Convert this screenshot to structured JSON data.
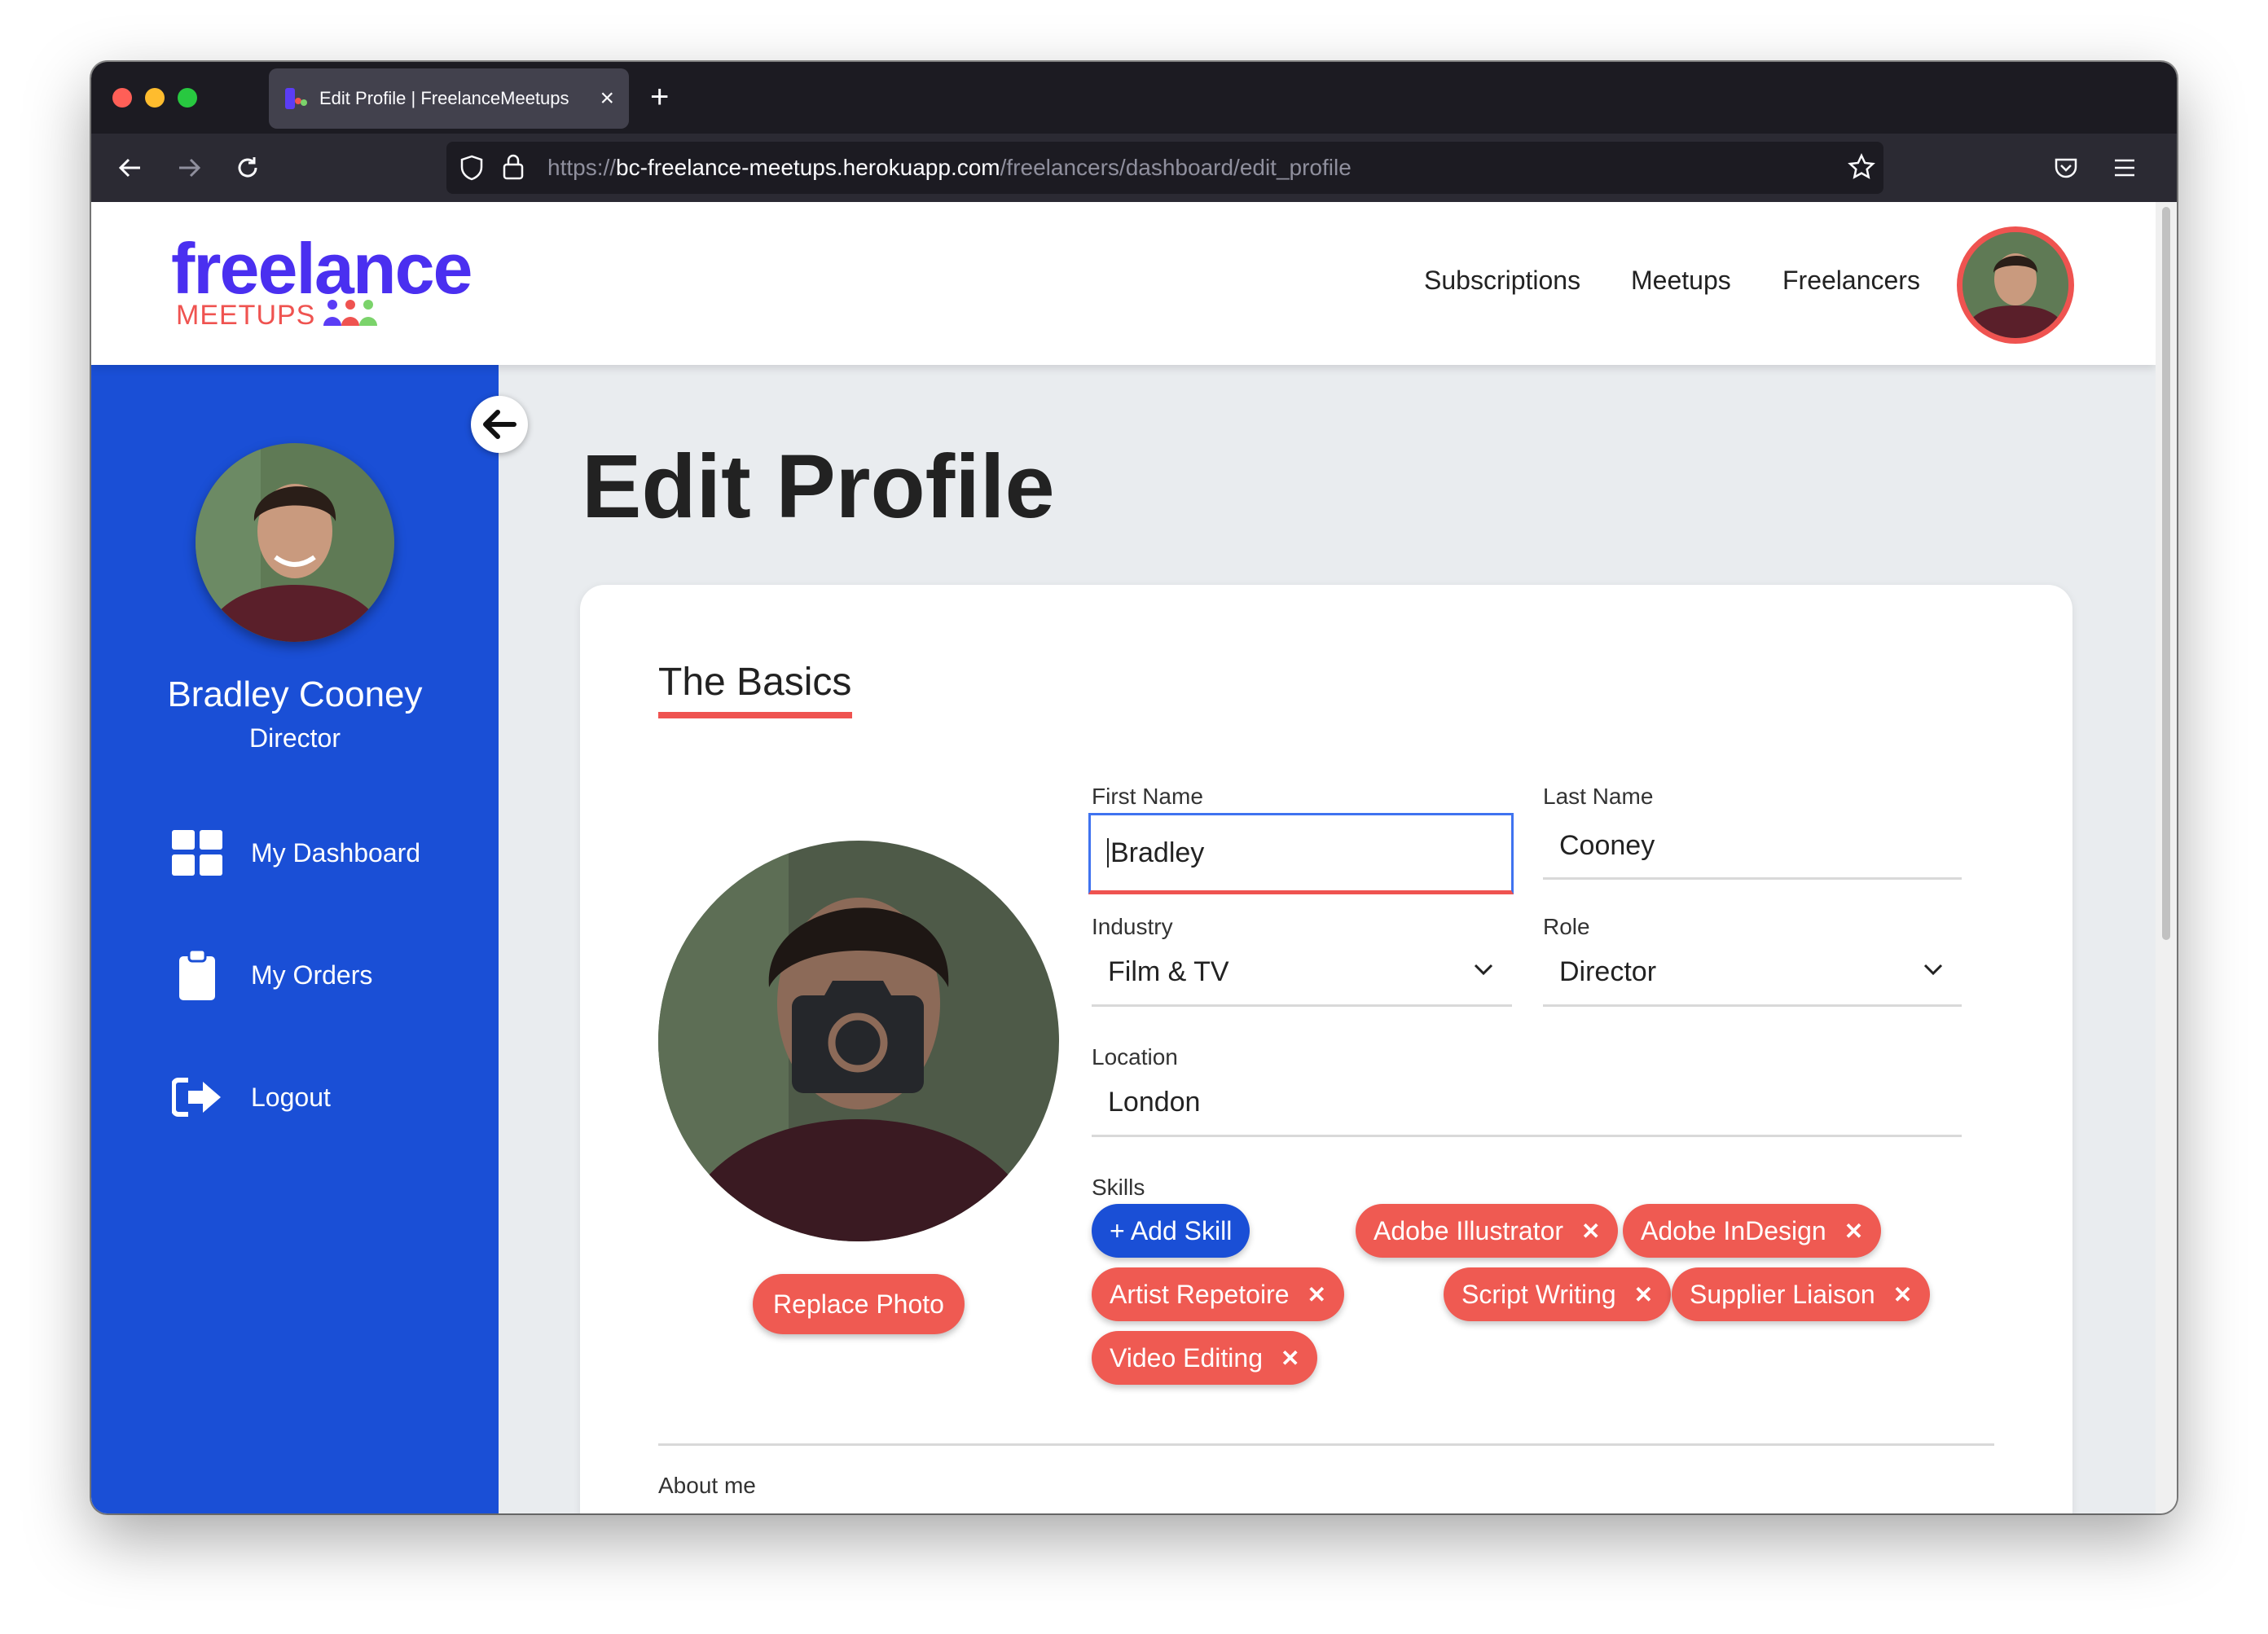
{
  "browser": {
    "tab_title": "Edit Profile | FreelanceMeetups",
    "url_prefix": "https://",
    "url_host": "bc-freelance-meetups.herokuapp.com",
    "url_path": "/freelancers/dashboard/edit_profile"
  },
  "header": {
    "logo_top": "freelance",
    "logo_bottom": "MEETUPS",
    "links": [
      "Subscriptions",
      "Meetups",
      "Freelancers"
    ]
  },
  "sidebar": {
    "name": "Bradley Cooney",
    "role": "Director",
    "items": [
      {
        "label": "My Dashboard",
        "icon": "dashboard-grid-icon"
      },
      {
        "label": "My Orders",
        "icon": "clipboard-icon"
      },
      {
        "label": "Logout",
        "icon": "logout-icon"
      }
    ]
  },
  "main": {
    "title": "Edit Profile",
    "section_title": "The Basics",
    "replace_photo": "Replace Photo",
    "fields": {
      "first_name": {
        "label": "First Name",
        "value": "Bradley"
      },
      "last_name": {
        "label": "Last Name",
        "value": "Cooney"
      },
      "industry": {
        "label": "Industry",
        "value": "Film & TV"
      },
      "role": {
        "label": "Role",
        "value": "Director"
      },
      "location": {
        "label": "Location",
        "value": "London"
      }
    },
    "skills_label": "Skills",
    "add_skill": "+ Add Skill",
    "skills": [
      "Adobe Illustrator",
      "Adobe InDesign",
      "Artist Repetoire",
      "Script Writing",
      "Supplier Liaison",
      "Video Editing"
    ],
    "about_label": "About me"
  },
  "colors": {
    "brand_blue": "#1a4fd6",
    "brand_red": "#ef5a52",
    "logo_purple": "#4a2ff0"
  }
}
